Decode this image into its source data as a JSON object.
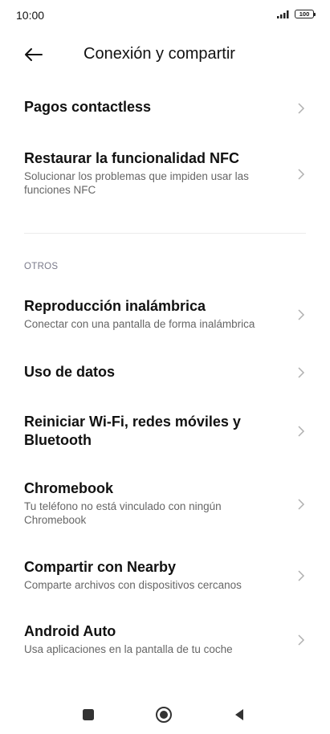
{
  "status_bar": {
    "time": "10:00",
    "battery": "100",
    "icons": [
      "signal-icon",
      "battery-icon"
    ]
  },
  "header": {
    "title": "Conexión y compartir",
    "back_icon": "arrow-left-icon"
  },
  "items_top": [
    {
      "title": "Pagos contactless",
      "subtitle": ""
    },
    {
      "title": "Restaurar la funcionalidad NFC",
      "subtitle": "Solucionar los problemas que impiden usar las funciones NFC"
    }
  ],
  "section": {
    "label": "OTROS"
  },
  "items_others": [
    {
      "title": "Reproducción inalámbrica",
      "subtitle": "Conectar con una pantalla de forma inalámbrica"
    },
    {
      "title": "Uso de datos",
      "subtitle": ""
    },
    {
      "title": "Reiniciar Wi-Fi, redes móviles y Bluetooth",
      "subtitle": ""
    },
    {
      "title": "Chromebook",
      "subtitle": "Tu teléfono no está vinculado con ningún Chromebook"
    },
    {
      "title": "Compartir con Nearby",
      "subtitle": "Comparte archivos con dispositivos cercanos"
    },
    {
      "title": "Android Auto",
      "subtitle": "Usa aplicaciones en la pantalla de tu coche"
    }
  ],
  "nav_bar": {
    "icons": [
      "recents-square-icon",
      "home-circle-icon",
      "back-triangle-icon"
    ]
  },
  "colors": {
    "text_primary": "#111111",
    "text_secondary": "#666666",
    "section_label": "#7a7a8a",
    "chevron": "#b0b0b0",
    "divider": "#ececec"
  }
}
